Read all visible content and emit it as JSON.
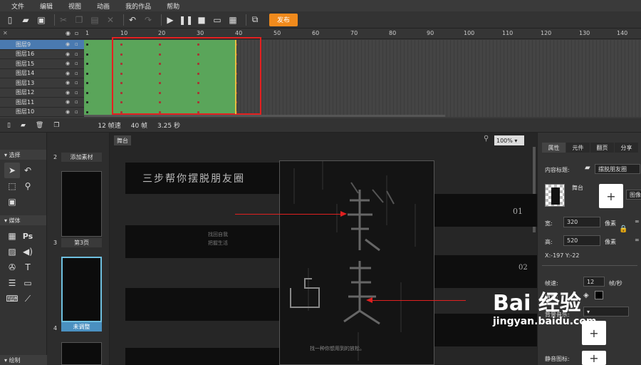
{
  "menu": [
    "文件",
    "编辑",
    "视图",
    "动画",
    "我的作品",
    "帮助"
  ],
  "toolbar": {
    "publish": "发布"
  },
  "timeline": {
    "ticks": [
      "1",
      "10",
      "20",
      "30",
      "40",
      "50",
      "60",
      "70",
      "80",
      "90",
      "100",
      "110",
      "120",
      "130",
      "140"
    ],
    "layers": [
      "图层9",
      "图层16",
      "图层15",
      "图层14",
      "图层13",
      "图层12",
      "图层11",
      "图层10"
    ],
    "status": {
      "fps": "12 帧速",
      "frames": "40 帧",
      "time": "3.25 秒"
    }
  },
  "left_panel": {
    "select_header": "选择",
    "media_header": "媒体",
    "draw_header": "绘制",
    "ps_label": "Ps"
  },
  "thumbs": [
    {
      "num": "2",
      "caption": "添加素材"
    },
    {
      "num": "3",
      "caption": "第3页"
    },
    {
      "num": "4",
      "caption": "未调整"
    }
  ],
  "stage": {
    "tab": "舞台",
    "zoom": "100%",
    "line1": "三步帮你摆脱朋友圈",
    "line2a": "找回自我",
    "line2b": "把握生活",
    "phone_bottom": "找一种你想用到的放松。",
    "tag1": "01",
    "tag2": "02"
  },
  "right_panel": {
    "tabs": [
      "属性",
      "元件",
      "翻页",
      "分享"
    ],
    "content_title_label": "内容标题:",
    "content_title": "摆脱朋友圈",
    "stage_label": "舞台",
    "image_btn": "图像",
    "width_label": "宽:",
    "width": "320",
    "height_label": "高:",
    "height": "520",
    "unit": "像素",
    "coords": "X:-197   Y:-22",
    "fps_label": "帧速:",
    "fps": "12",
    "fps_unit": "帧/秒",
    "fill_label": "填充:",
    "music_label": "背景音乐:",
    "icon_label": "静音图标:"
  },
  "watermark": {
    "text": "Bai 经验",
    "url": "jingyan.baidu.com"
  },
  "colors": {
    "accent": "#f08a1c",
    "selected": "#4a7ab0",
    "frame_green": "#5aa55a",
    "highlight": "#e52020"
  }
}
